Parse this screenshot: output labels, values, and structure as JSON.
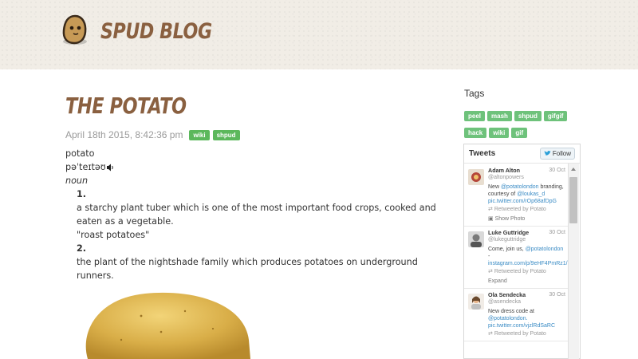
{
  "header": {
    "site_title": "SPUD BLOG"
  },
  "post": {
    "title": "THE POTATO",
    "date": "April 18th 2015, 8:42:36 pm",
    "tags": [
      "wiki",
      "shpud"
    ],
    "definition": {
      "word": "potato",
      "pronunciation": "pəˈteɪtəʊ",
      "part_of_speech": "noun",
      "sense1_num": "1.",
      "sense1_text": "a starchy plant tuber which is one of the most important food crops, cooked and eaten as a vegetable.",
      "sense1_example": "\"roast potatoes\"",
      "sense2_num": "2.",
      "sense2_text": "the plant of the nightshade family which produces potatoes on underground runners."
    }
  },
  "sidebar": {
    "tags_heading": "Tags",
    "tags": [
      "peel",
      "mash",
      "shpud",
      "gifgif",
      "hack",
      "wiki",
      "gif"
    ],
    "tweets_title": "Tweets",
    "follow_label": "Follow",
    "tweets": [
      {
        "name": "Adam Alton",
        "handle": "@altonpowers",
        "date": "30 Oct",
        "text_prefix": "New ",
        "link1": "@potatolondon",
        "text_mid": " branding, courtesy of ",
        "link2": "@loukas_d",
        "link3": "pic.twitter.com/rOp68afDpG",
        "retweeted": "Retweeted by Potato",
        "action": "Show Photo"
      },
      {
        "name": "Luke Guttridge",
        "handle": "@lukeguttridge",
        "date": "30 Oct",
        "text_prefix": "Come, join us, ",
        "link1": "@potatolondon",
        "text_mid": " - ",
        "link2": "instagram.com/p/9eHF4PmRz1/",
        "link3": "",
        "retweeted": "Retweeted by Potato",
        "action": "Expand"
      },
      {
        "name": "Ola Sendecka",
        "handle": "@asendecka",
        "date": "30 Oct",
        "text_prefix": "New dress code at ",
        "link1": "@potatolondon.",
        "text_mid": " ",
        "link2": "pic.twitter.com/vjzlRdSaRC",
        "link3": "",
        "retweeted": "Retweeted by Potato",
        "action": ""
      }
    ]
  },
  "colors": {
    "brand_brown": "#8a6040",
    "tag_green": "#5cb85c",
    "link_blue": "#3b8cc5"
  }
}
